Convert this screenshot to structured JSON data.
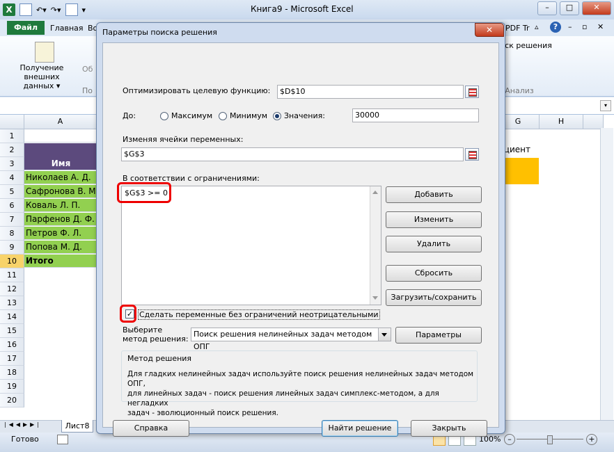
{
  "app": {
    "window_title": "Книга9  -  Microsoft Excel",
    "logo": "X"
  },
  "ribbon": {
    "tabs": [
      "Файл",
      "Главная",
      "Во",
      "PDF Tr"
    ],
    "get_data_label": "Получение внешних данных ▾",
    "partial_label": "Об",
    "partial_group": "По",
    "analysis_group": "Анализ",
    "solver_label": "иск решения"
  },
  "grid": {
    "columns": [
      "A",
      "G",
      "H"
    ],
    "rows": [
      "1",
      "2",
      "3",
      "4",
      "5",
      "6",
      "7",
      "8",
      "9",
      "10",
      "11",
      "12",
      "13",
      "14",
      "15",
      "16",
      "17",
      "18",
      "19",
      "20"
    ],
    "colA": [
      "",
      "",
      "Имя",
      "Николаев А. Д.",
      "Сафронова В. М",
      "Коваль Л. П.",
      "Парфенов Д. Ф.",
      "Петров Ф. Л.",
      "Попова М. Д.",
      "Итого"
    ],
    "coef_label": "ициент"
  },
  "sheet": {
    "tab": "Лист8",
    "status": "Готово",
    "zoom": "100%"
  },
  "dialog": {
    "title": "Параметры поиска решения",
    "close": "✕",
    "objective_label": "Оптимизировать целевую функцию:",
    "objective_value": "$D$10",
    "to_label": "До:",
    "radio_max": "Максимум",
    "radio_min": "Минимум",
    "radio_value": "Значения:",
    "value_input": "30000",
    "selected_radio": "value",
    "changing_label": "Изменяя ячейки переменных:",
    "changing_value": "$G$3",
    "constraints_label": "В соответствии с ограничениями:",
    "constraints": [
      "$G$3 >= 0"
    ],
    "buttons": {
      "add": "Добавить",
      "change": "Изменить",
      "delete": "Удалить",
      "reset": "Сбросить",
      "load_save": "Загрузить/сохранить",
      "options": "Параметры",
      "help": "Справка",
      "solve": "Найти решение",
      "close": "Закрыть"
    },
    "nonneg_label": "Сделать переменные без ограничений неотрицательными",
    "nonneg_checked": "✓",
    "method_label_1": "Выберите",
    "method_label_2": "метод решения:",
    "method_value": "Поиск решения нелинейных задач методом ОПГ",
    "method_group_title": "Метод решения",
    "method_desc_1": "Для гладких нелинейных задач используйте поиск решения нелинейных задач методом ОПГ,",
    "method_desc_2": "для линейных задач - поиск решения линейных задач симплекс-методом, а для негладких",
    "method_desc_3": "задач - эволюционный поиск решения."
  }
}
